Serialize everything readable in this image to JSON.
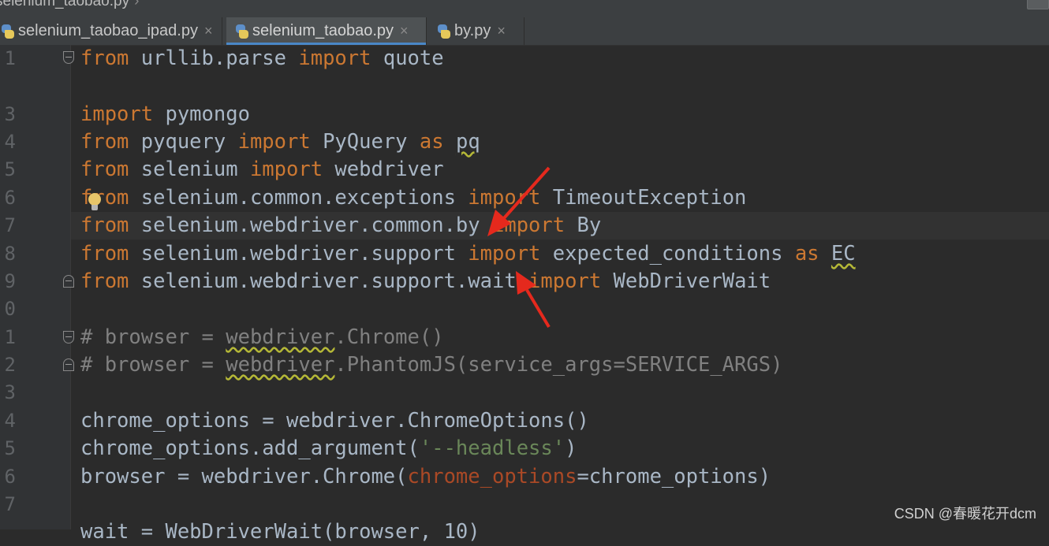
{
  "breadcrumb": {
    "file": "selenium_taobao.py",
    "chevron": "›"
  },
  "tabs": [
    {
      "label": "selenium_taobao_ipad.py",
      "close": "×",
      "icon": "python-file-icon",
      "active": false
    },
    {
      "label": "selenium_taobao.py",
      "close": "×",
      "icon": "python-file-icon",
      "active": true
    },
    {
      "label": "by.py",
      "close": "×",
      "icon": "python-file-icon",
      "active": false
    }
  ],
  "gutter": {
    "line_numbers": [
      "1",
      "",
      "3",
      "4",
      "5",
      "6",
      "7",
      "8",
      "9",
      "0",
      "1",
      "2",
      "3",
      "4",
      "5",
      "6",
      "7"
    ]
  },
  "code": {
    "line1": {
      "a": "from",
      "b": " urllib.parse ",
      "c": "import",
      "d": " quote"
    },
    "line3": {
      "a": "import",
      "b": " pymongo"
    },
    "line4": {
      "a": "from",
      "b": " pyquery ",
      "c": "import",
      "d": " PyQuery ",
      "e": "as",
      "f": " ",
      "g": "pq"
    },
    "line5": {
      "a": "from",
      "b": " selenium ",
      "c": "import",
      "d": " webdriver"
    },
    "line6": {
      "a": "from",
      "b": " selenium.common.exceptions ",
      "c": "import",
      "d": " TimeoutException"
    },
    "line7": {
      "a": "from",
      "b": " selenium.webdriver.common.by ",
      "c": "import",
      "d": " By"
    },
    "line8": {
      "a": "from",
      "b": " selenium.webdriver.support ",
      "c": "import",
      "d": " expected_conditions ",
      "e": "as",
      "f": " ",
      "g": "EC"
    },
    "line9": {
      "a": "from",
      "b": " selenium.webdriver.support.wait ",
      "c": "import",
      "d": " WebDriverWait"
    },
    "line11": {
      "a": "# browser = ",
      "b": "webdriver",
      "c": ".Chrome()"
    },
    "line12": {
      "a": "# browser = ",
      "b": "webdriver",
      "c": ".PhantomJS(service_args=SERVICE_ARGS)"
    },
    "line14": {
      "a": "chrome_options = webdriver.ChromeOptions()"
    },
    "line15": {
      "a": "chrome_options.add_argument(",
      "b": "'--headless'",
      "c": ")"
    },
    "line16": {
      "a": "browser = webdriver.Chrome(",
      "b": "chrome_options",
      "c": "=chrome_options)"
    },
    "line18": {
      "a": "wait = WebDriverWait(browser, 10)"
    }
  },
  "colors": {
    "keyword": "#cc7832",
    "text": "#a9b7c6",
    "comment": "#808080",
    "string": "#6a8759",
    "param": "#aa4926",
    "annotation_arrow": "#e5291d"
  },
  "watermark": "CSDN @春暖花开dcm"
}
